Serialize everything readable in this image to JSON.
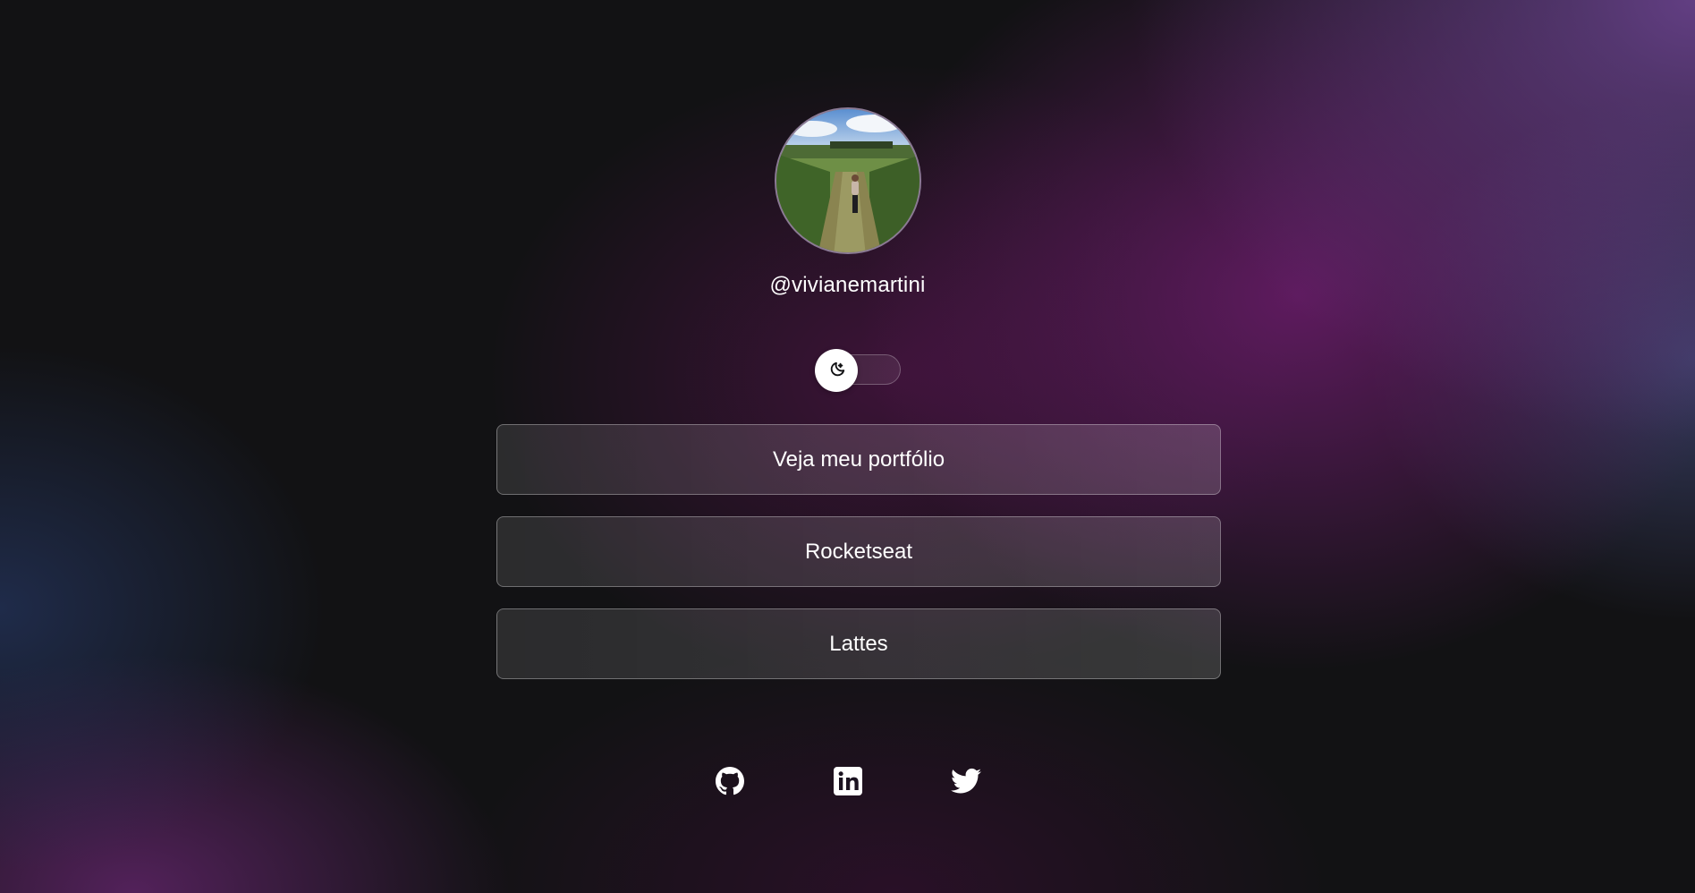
{
  "profile": {
    "username": "@vivianemartini",
    "avatar_alt": "Profile photo in a vineyard"
  },
  "theme_switch": {
    "icon": "moon-stars-icon",
    "state": "dark"
  },
  "links": [
    {
      "label": "Veja meu portfólio"
    },
    {
      "label": "Rocketseat"
    },
    {
      "label": "Lattes"
    }
  ],
  "social": [
    {
      "icon": "github-icon"
    },
    {
      "icon": "linkedin-icon"
    },
    {
      "icon": "twitter-icon"
    }
  ],
  "colors": {
    "background_base": "#121214",
    "accent_purple": "#6f3d8c",
    "text": "#ffffff"
  }
}
